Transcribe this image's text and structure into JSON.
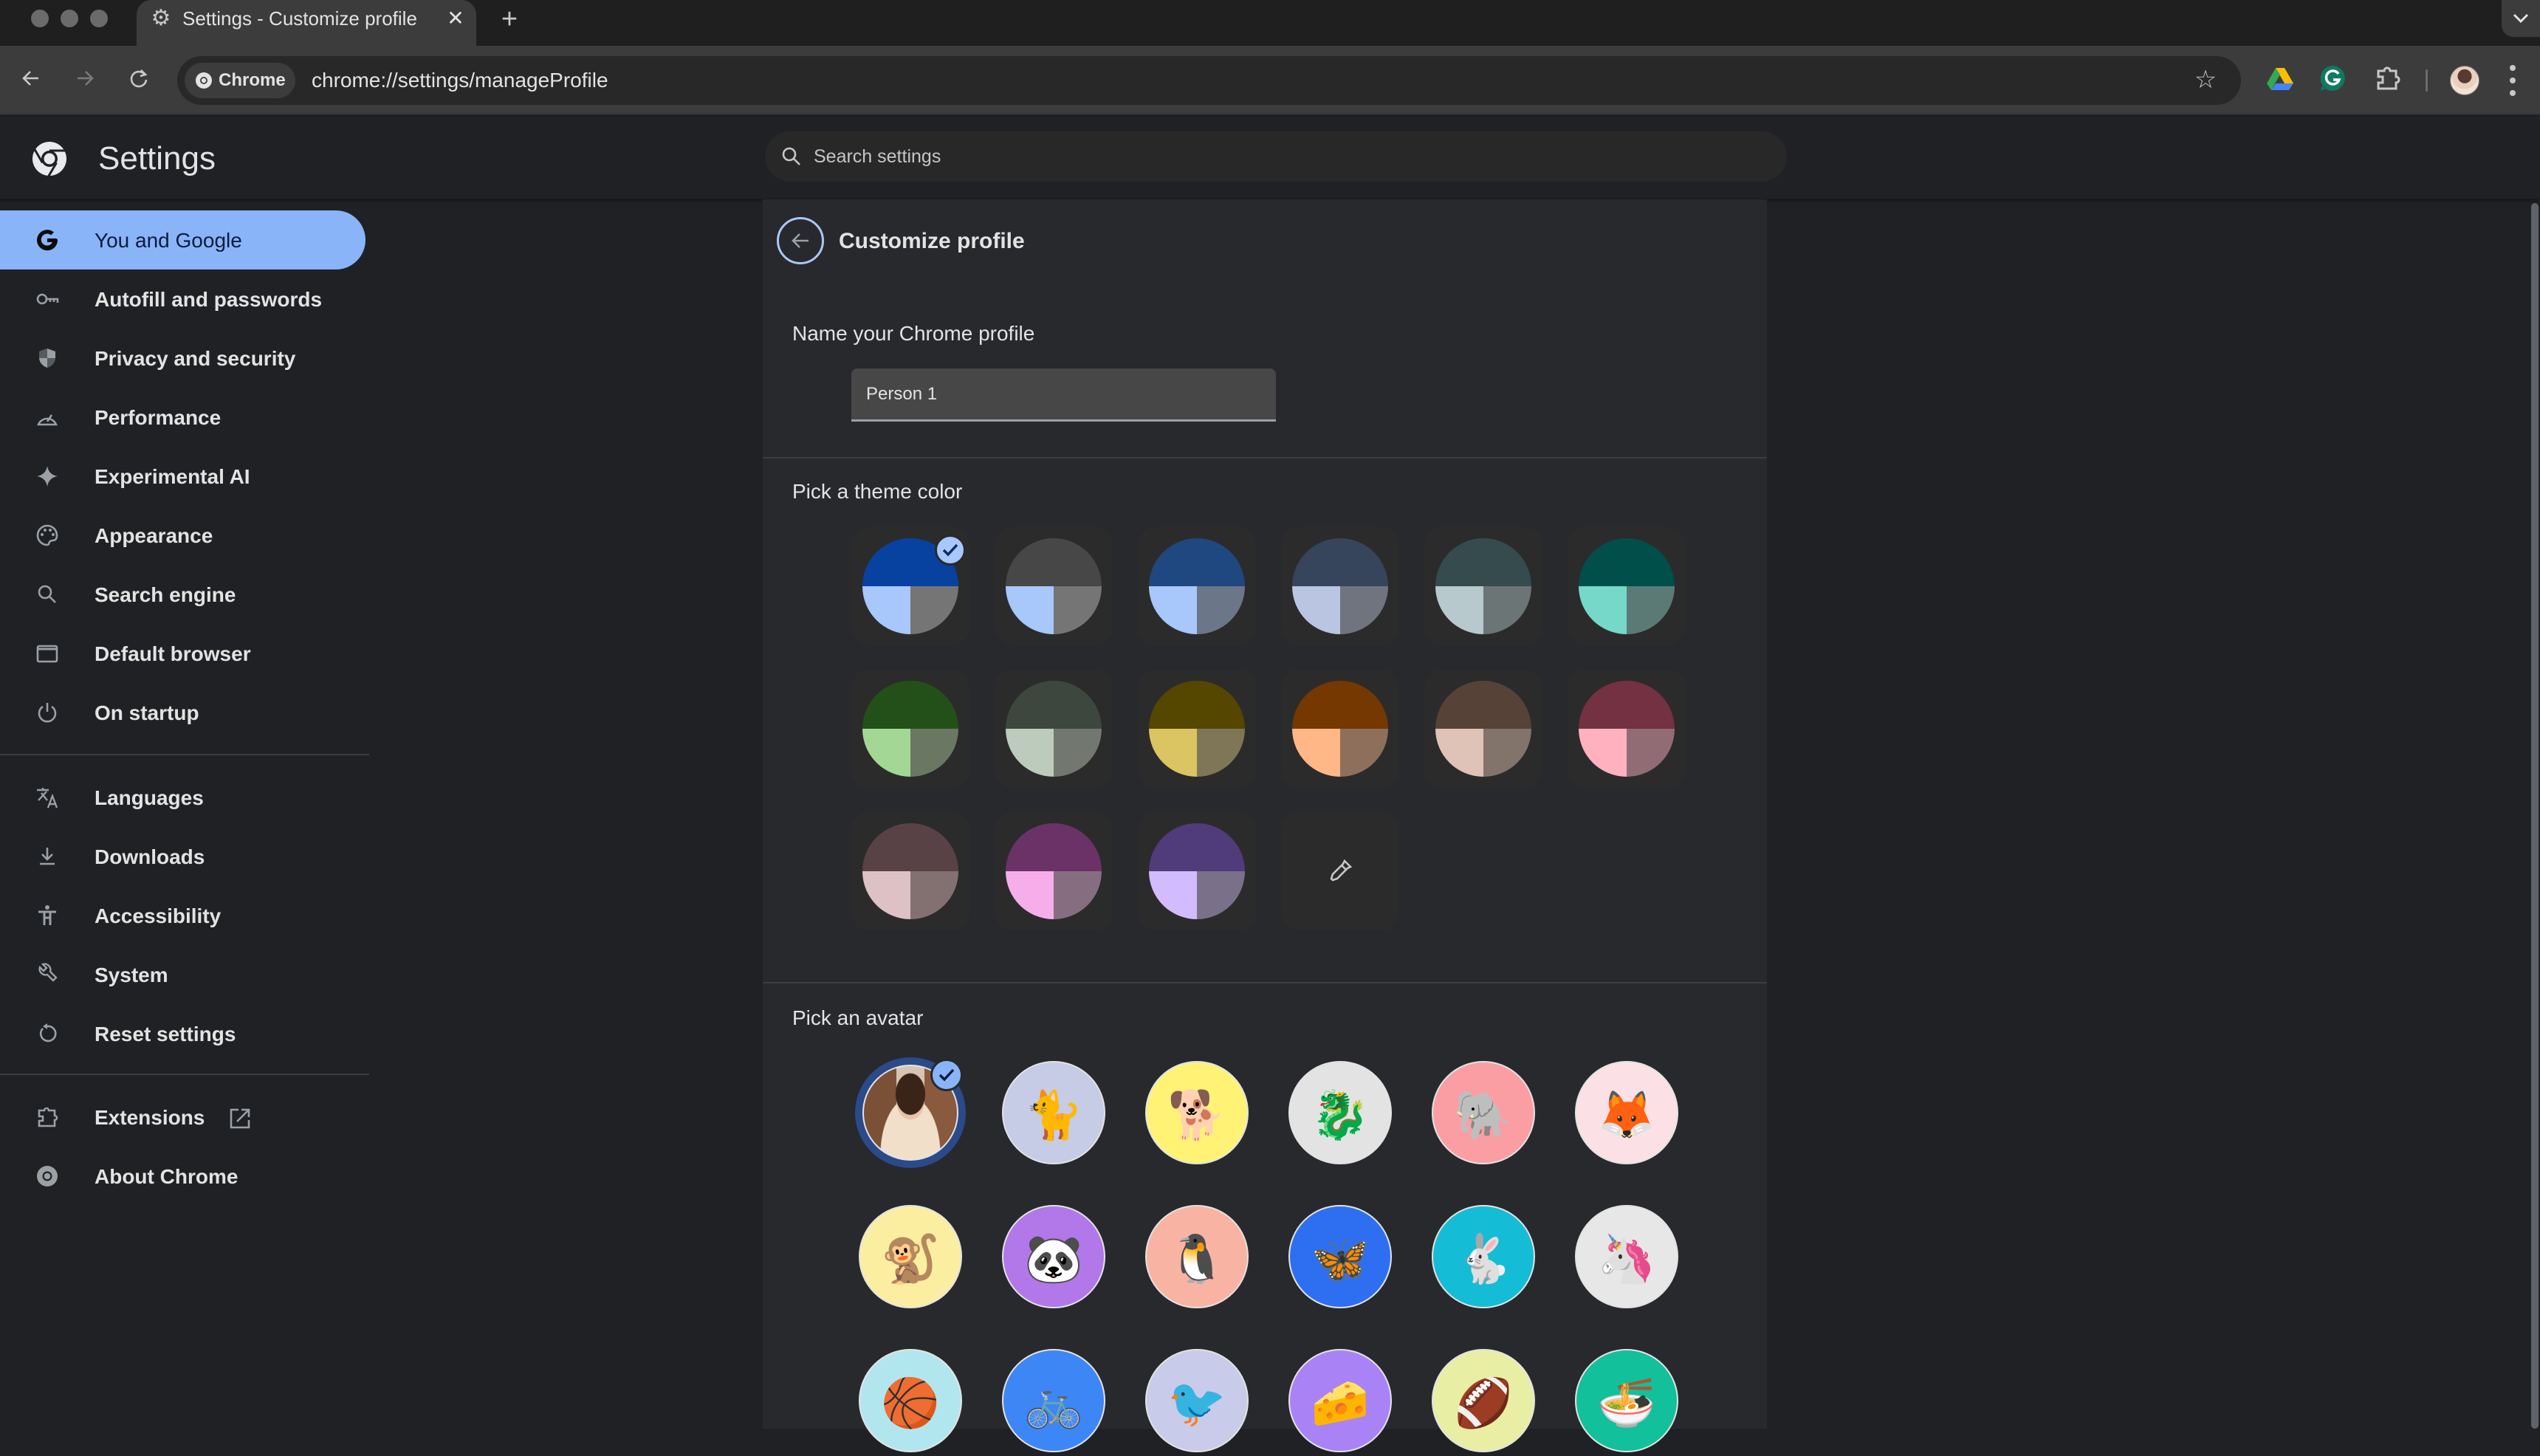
{
  "browser": {
    "tab": {
      "title": "Settings - Customize profile",
      "icon": "gear-icon",
      "close_glyph": "✕"
    },
    "new_tab_glyph": "+",
    "tab_search_glyph": "⌄",
    "omnibox": {
      "chip_label": "Chrome",
      "url": "chrome://settings/manageProfile"
    },
    "nav": {
      "back": "←",
      "forward": "→",
      "reload": "↻"
    },
    "bookmark_glyph": "☆",
    "extensions": [
      "google-drive-icon",
      "grammarly-icon",
      "extensions-puzzle-icon"
    ]
  },
  "settings": {
    "title": "Settings",
    "search": {
      "placeholder": "Search settings",
      "value": ""
    }
  },
  "sidebar": {
    "items": [
      {
        "label": "You and Google",
        "icon": "google-g-icon",
        "active": true
      },
      {
        "label": "Autofill and passwords",
        "icon": "key-icon"
      },
      {
        "label": "Privacy and security",
        "icon": "shield-icon"
      },
      {
        "label": "Performance",
        "icon": "speedometer-icon"
      },
      {
        "label": "Experimental AI",
        "icon": "sparkle-icon"
      },
      {
        "label": "Appearance",
        "icon": "palette-icon"
      },
      {
        "label": "Search engine",
        "icon": "search-icon"
      },
      {
        "label": "Default browser",
        "icon": "browser-window-icon"
      },
      {
        "label": "On startup",
        "icon": "power-icon"
      },
      {
        "label": "Languages",
        "icon": "translate-icon"
      },
      {
        "label": "Downloads",
        "icon": "download-icon"
      },
      {
        "label": "Accessibility",
        "icon": "accessibility-icon"
      },
      {
        "label": "System",
        "icon": "wrench-icon"
      },
      {
        "label": "Reset settings",
        "icon": "reset-icon"
      },
      {
        "label": "Extensions",
        "icon": "extensions-puzzle-icon",
        "external": true
      },
      {
        "label": "About Chrome",
        "icon": "chrome-logo-icon"
      }
    ]
  },
  "page": {
    "title": "Customize profile",
    "name_section": {
      "label": "Name your Chrome profile",
      "value": "Person 1"
    },
    "theme_section": {
      "label": "Pick a theme color",
      "selected_index": 0,
      "colors": [
        {
          "top": "#0842a0",
          "bl": "#a8c7fa",
          "br": "#757575"
        },
        {
          "top": "#474747",
          "bl": "#a8c7fa",
          "br": "#757575"
        },
        {
          "top": "#1f4780",
          "bl": "#a8c7fa",
          "br": "#6c7689"
        },
        {
          "top": "#36445c",
          "bl": "#b9c5e1",
          "br": "#6f747f"
        },
        {
          "top": "#364b4d",
          "bl": "#b7c9cc",
          "br": "#6b7576"
        },
        {
          "top": "#004f4a",
          "bl": "#75d8c8",
          "br": "#5b7a75"
        },
        {
          "top": "#235019",
          "bl": "#a2d795",
          "br": "#6a7863"
        },
        {
          "top": "#3e473d",
          "bl": "#bccbbb",
          "br": "#72776f"
        },
        {
          "top": "#554600",
          "bl": "#dbc462",
          "br": "#7e7656"
        },
        {
          "top": "#743800",
          "bl": "#ffb787",
          "br": "#8e6f5c"
        },
        {
          "top": "#574237",
          "bl": "#dec3b6",
          "br": "#82736b"
        },
        {
          "top": "#733142",
          "bl": "#ffb1c0",
          "br": "#926c74"
        },
        {
          "top": "#584246",
          "bl": "#dec1c4",
          "br": "#837172"
        },
        {
          "top": "#6b3267",
          "bl": "#f6aeeb",
          "br": "#866e81"
        },
        {
          "top": "#503b7b",
          "bl": "#d3bbff",
          "br": "#7a7089"
        }
      ],
      "custom_picker_icon": "eyedropper-icon"
    },
    "avatar_section": {
      "label": "Pick an avatar",
      "selected_index": 0,
      "avatars": [
        {
          "name": "profile-photo",
          "bg": "#d9c3b0",
          "glyph": ""
        },
        {
          "name": "origami-cat",
          "bg": "#c6cbe6",
          "glyph": "🐈"
        },
        {
          "name": "origami-corgi",
          "bg": "#fff275",
          "glyph": "🐕"
        },
        {
          "name": "origami-dragon",
          "bg": "#e3e3e3",
          "glyph": "🐉"
        },
        {
          "name": "origami-elephant",
          "bg": "#fb9ea4",
          "glyph": "🐘"
        },
        {
          "name": "origami-fox",
          "bg": "#fbe1e6",
          "glyph": "🦊"
        },
        {
          "name": "origami-monkey",
          "bg": "#fbeea0",
          "glyph": "🐒"
        },
        {
          "name": "origami-panda",
          "bg": "#b277e8",
          "glyph": "🐼"
        },
        {
          "name": "origami-penguin",
          "bg": "#f9b3a3",
          "glyph": "🐧"
        },
        {
          "name": "origami-butterfly",
          "bg": "#2d6ff0",
          "glyph": "🦋"
        },
        {
          "name": "origami-rabbit",
          "bg": "#15bcd6",
          "glyph": "🐇"
        },
        {
          "name": "origami-unicorn",
          "bg": "#e7e7e7",
          "glyph": "🦄"
        },
        {
          "name": "basketball",
          "bg": "#b2e6ef",
          "glyph": "🏀"
        },
        {
          "name": "bike",
          "bg": "#3d86f6",
          "glyph": "🚲"
        },
        {
          "name": "cardinal",
          "bg": "#c8cbe9",
          "glyph": "🐦"
        },
        {
          "name": "cheese",
          "bg": "#a983f5",
          "glyph": "🧀"
        },
        {
          "name": "football",
          "bg": "#e8eea3",
          "glyph": "🏈"
        },
        {
          "name": "ramen",
          "bg": "#12c09c",
          "glyph": "🍜"
        }
      ]
    }
  }
}
